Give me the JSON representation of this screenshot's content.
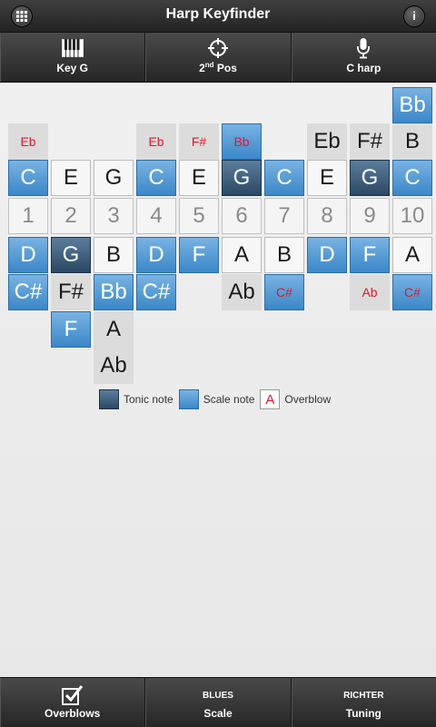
{
  "header": {
    "title": "Harp Keyfinder",
    "menu_icon": "grid-icon",
    "info_icon": "info-icon",
    "info_glyph": "i"
  },
  "toolbar_top": {
    "key_label": "Key G",
    "position_num": "2",
    "position_sup": "nd",
    "position_rest": " Pos",
    "harp_label": "C harp"
  },
  "holes": [
    "1",
    "2",
    "3",
    "4",
    "5",
    "6",
    "7",
    "8",
    "9",
    "10"
  ],
  "grid": {
    "row_top": [
      null,
      null,
      null,
      null,
      null,
      null,
      null,
      null,
      null,
      {
        "note": "Bb",
        "type": "scale"
      }
    ],
    "row_overblow": [
      {
        "note": "Eb",
        "type": "ob"
      },
      null,
      null,
      {
        "note": "Eb",
        "type": "ob"
      },
      {
        "note": "F#",
        "type": "ob"
      },
      {
        "note": "Bb",
        "type": "ob-scale"
      },
      null,
      {
        "note": "Eb",
        "type": "plain"
      },
      {
        "note": "F#",
        "type": "plain"
      },
      {
        "note": "B",
        "type": "plain"
      }
    ],
    "row_blow": [
      {
        "note": "C",
        "type": "scale"
      },
      {
        "note": "E",
        "type": "white"
      },
      {
        "note": "G",
        "type": "white"
      },
      {
        "note": "C",
        "type": "scale"
      },
      {
        "note": "E",
        "type": "white"
      },
      {
        "note": "G",
        "type": "tonic"
      },
      {
        "note": "C",
        "type": "scale"
      },
      {
        "note": "E",
        "type": "white"
      },
      {
        "note": "G",
        "type": "tonic"
      },
      {
        "note": "C",
        "type": "scale"
      }
    ],
    "row_draw": [
      {
        "note": "D",
        "type": "scale"
      },
      {
        "note": "G",
        "type": "tonic"
      },
      {
        "note": "B",
        "type": "white"
      },
      {
        "note": "D",
        "type": "scale"
      },
      {
        "note": "F",
        "type": "scale"
      },
      {
        "note": "A",
        "type": "white"
      },
      {
        "note": "B",
        "type": "white"
      },
      {
        "note": "D",
        "type": "scale"
      },
      {
        "note": "F",
        "type": "scale"
      },
      {
        "note": "A",
        "type": "white"
      }
    ],
    "row_bend1": [
      {
        "note": "C#",
        "type": "scale"
      },
      {
        "note": "F#",
        "type": "plain"
      },
      {
        "note": "Bb",
        "type": "scale"
      },
      {
        "note": "C#",
        "type": "scale"
      },
      null,
      {
        "note": "Ab",
        "type": "plain"
      },
      {
        "note": "C#",
        "type": "ob-scale"
      },
      null,
      {
        "note": "Ab",
        "type": "ob"
      },
      {
        "note": "C#",
        "type": "ob-scale"
      }
    ],
    "row_bend2": [
      null,
      {
        "note": "F",
        "type": "scale"
      },
      {
        "note": "A",
        "type": "plain"
      },
      null,
      null,
      null,
      null,
      null,
      null,
      null
    ],
    "row_bend3": [
      null,
      null,
      {
        "note": "Ab",
        "type": "plain"
      },
      null,
      null,
      null,
      null,
      null,
      null,
      null
    ]
  },
  "legend": {
    "tonic_label": "Tonic note",
    "scale_label": "Scale note",
    "overblow_glyph": "A",
    "overblow_label": "Overblow"
  },
  "toolbar_bottom": {
    "overblows_label": "Overblows",
    "scale_top": "BLUES",
    "scale_label": "Scale",
    "tuning_top": "RICHTER",
    "tuning_label": "Tuning"
  }
}
